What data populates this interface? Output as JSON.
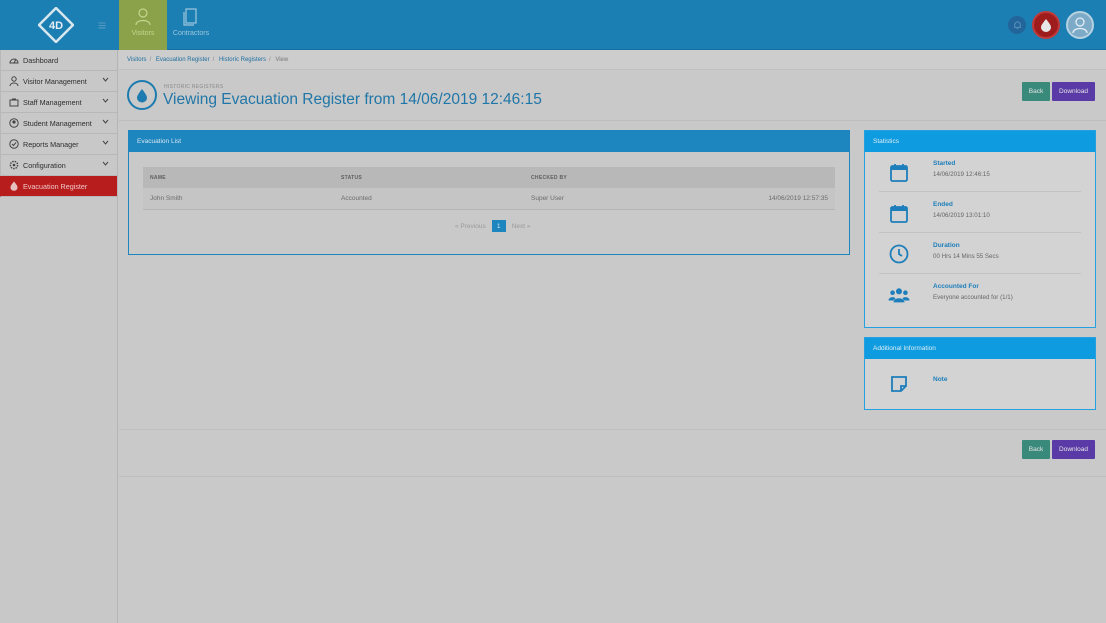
{
  "header": {
    "logo_text": "4D",
    "tabs": [
      {
        "label": "Visitors",
        "icon": "user-icon",
        "active": true
      },
      {
        "label": "Contractors",
        "icon": "document-icon",
        "active": false
      }
    ]
  },
  "sidebar": {
    "items": [
      {
        "label": "Dashboard",
        "icon": "gauge-icon",
        "has_chevron": false,
        "active": false
      },
      {
        "label": "Visitor Management",
        "icon": "user-icon",
        "has_chevron": true,
        "active": false
      },
      {
        "label": "Staff Management",
        "icon": "staff-icon",
        "has_chevron": true,
        "active": false
      },
      {
        "label": "Student Management",
        "icon": "student-icon",
        "has_chevron": true,
        "active": false
      },
      {
        "label": "Reports Manager",
        "icon": "reports-icon",
        "has_chevron": true,
        "active": false
      },
      {
        "label": "Configuration",
        "icon": "gear-icon",
        "has_chevron": true,
        "active": false
      },
      {
        "label": "Evacuation Register",
        "icon": "flame-icon",
        "has_chevron": false,
        "active": true
      }
    ]
  },
  "breadcrumb": {
    "items": [
      "Visitors",
      "Evacuation Register",
      "Historic Registers"
    ],
    "current": "View"
  },
  "page": {
    "subtitle": "HISTORIC REGISTERS",
    "title": "Viewing Evacuation Register from 14/06/2019 12:46:15",
    "back_label": "Back",
    "download_label": "Download"
  },
  "evacuation_list": {
    "title": "Evacuation List",
    "columns": [
      "NAME",
      "STATUS",
      "CHECKED BY"
    ],
    "rows": [
      {
        "name": "John Smith",
        "status": "Accounted",
        "checked_by": "Super User",
        "time": "14/06/2019 12:57:35"
      }
    ],
    "pager": {
      "prev": "Previous",
      "page": "1",
      "next": "Next"
    }
  },
  "statistics": {
    "title": "Statistics",
    "items": [
      {
        "label": "Started",
        "value": "14/06/2019 12:46:15",
        "icon": "calendar-icon"
      },
      {
        "label": "Ended",
        "value": "14/06/2019 13:01:10",
        "icon": "calendar-icon"
      },
      {
        "label": "Duration",
        "value": "00 Hrs 14 Mins 55 Secs",
        "icon": "clock-icon"
      },
      {
        "label": "Accounted For",
        "value": "Everyone accounted for (1/1)",
        "icon": "users-icon"
      }
    ]
  },
  "additional_info": {
    "title": "Additional Information",
    "note_label": "Note"
  },
  "colors": {
    "header_blue": "#1b7fb4",
    "panel_blue": "#1e86bf",
    "active_red": "#b71d1d",
    "back_green": "#3a8a7c",
    "download_purple": "#5a3aa6"
  }
}
